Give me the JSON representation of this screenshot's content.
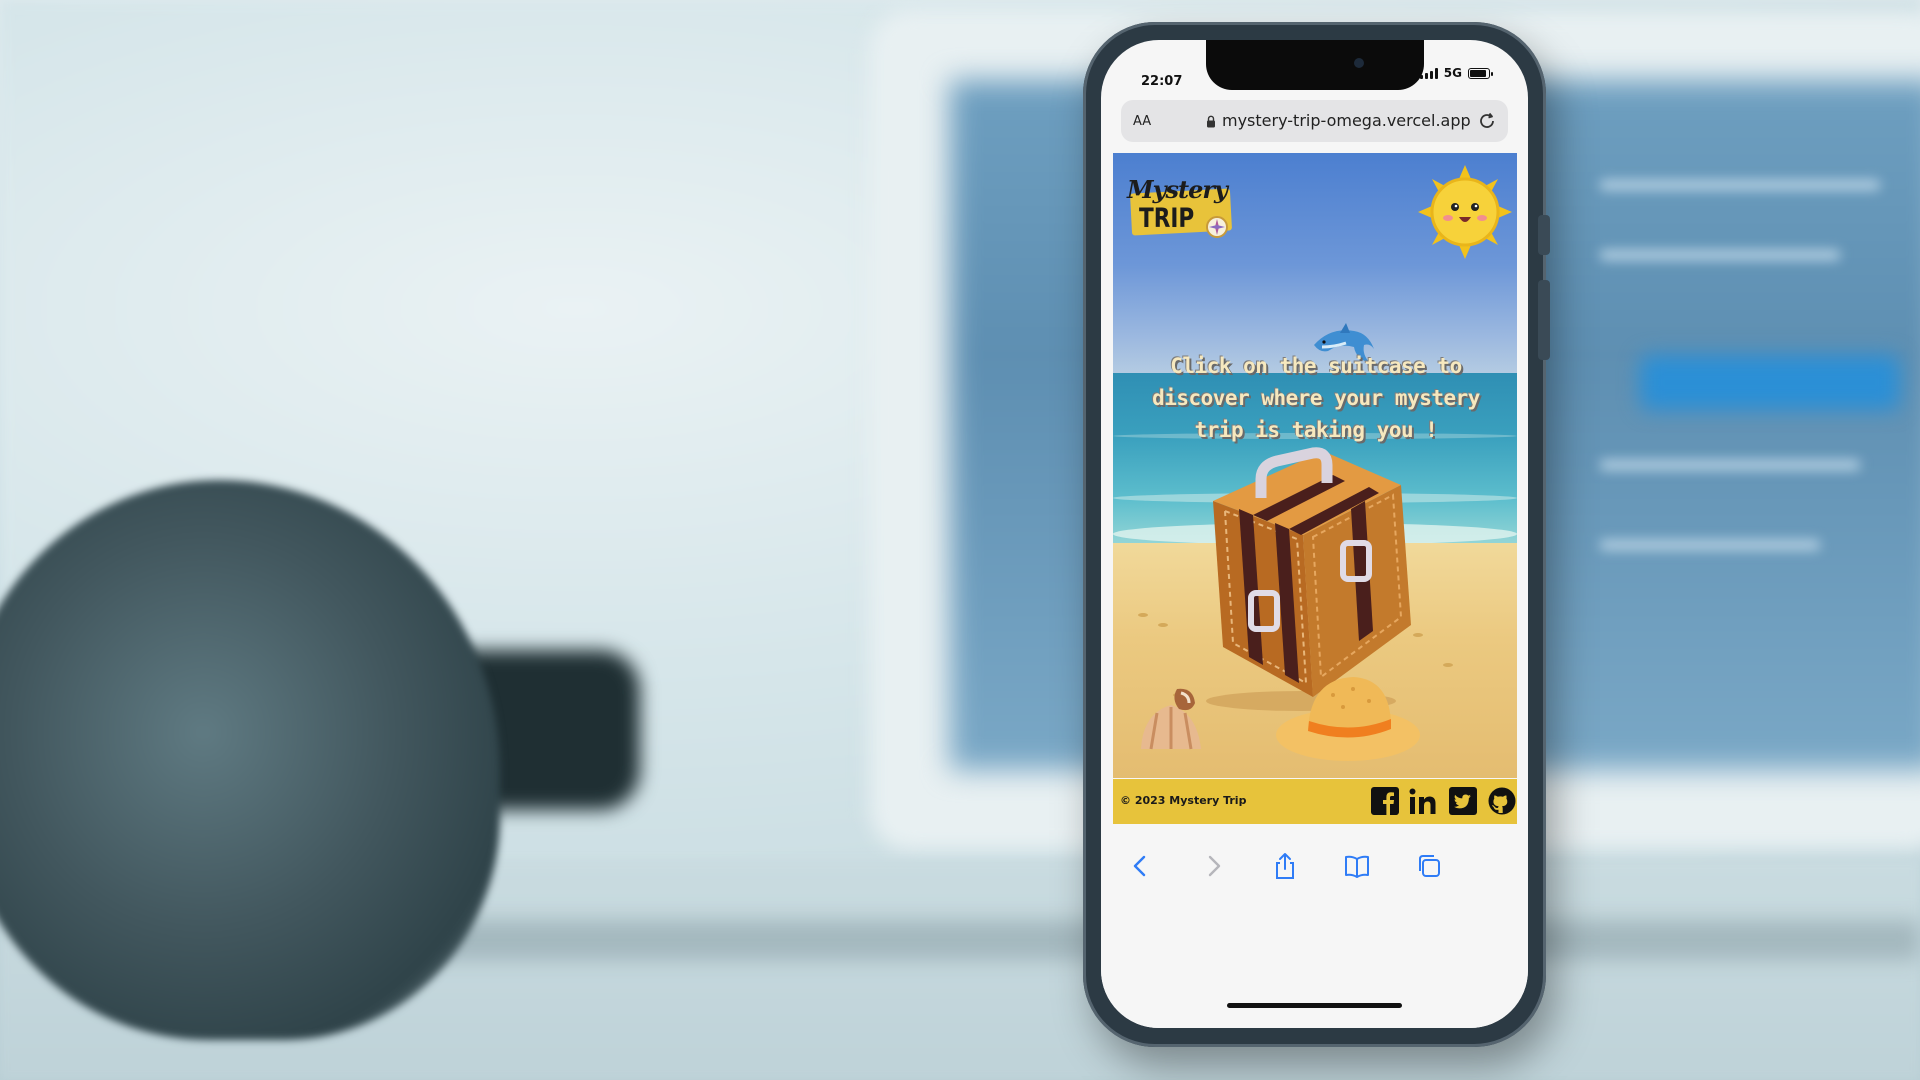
{
  "status_bar": {
    "time": "22:07",
    "network": "5G",
    "battery_level": 0.9
  },
  "browser": {
    "text_size_label": "AA",
    "url": "mystery-trip-omega.vercel.app"
  },
  "page": {
    "logo": {
      "script_text": "Mystery",
      "trip_text": "TRIP"
    },
    "headline": "Click on the suitcase to discover where your mystery trip is taking you !",
    "footer": {
      "copyright": "© 2023 Mystery Trip"
    },
    "social_icons": [
      "facebook-icon",
      "linkedin-icon",
      "twitter-icon",
      "github-icon"
    ]
  },
  "toolbar": {
    "icons": [
      "back-icon",
      "forward-icon",
      "share-icon",
      "bookmarks-icon",
      "tabs-icon"
    ]
  },
  "colors": {
    "footer_yellow": "#e7c33b",
    "headline": "#f6e8be",
    "toolbar_blue": "#2f7cf6"
  }
}
